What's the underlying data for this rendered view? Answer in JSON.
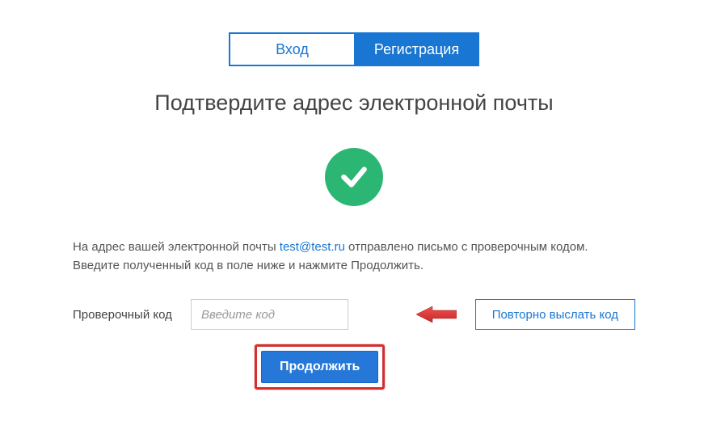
{
  "tabs": {
    "login": "Вход",
    "register": "Регистрация"
  },
  "heading": "Подтвердите адрес электронной почты",
  "message": {
    "part1": "На адрес вашей электронной почты ",
    "email": "test@test.ru",
    "part2": " отправлено письмо с проверочным кодом. Введите полученный код в поле ниже и нажмите Продолжить."
  },
  "form": {
    "code_label": "Проверочный код",
    "code_placeholder": "Введите код",
    "resend_label": "Повторно выслать код",
    "continue_label": "Продолжить"
  }
}
